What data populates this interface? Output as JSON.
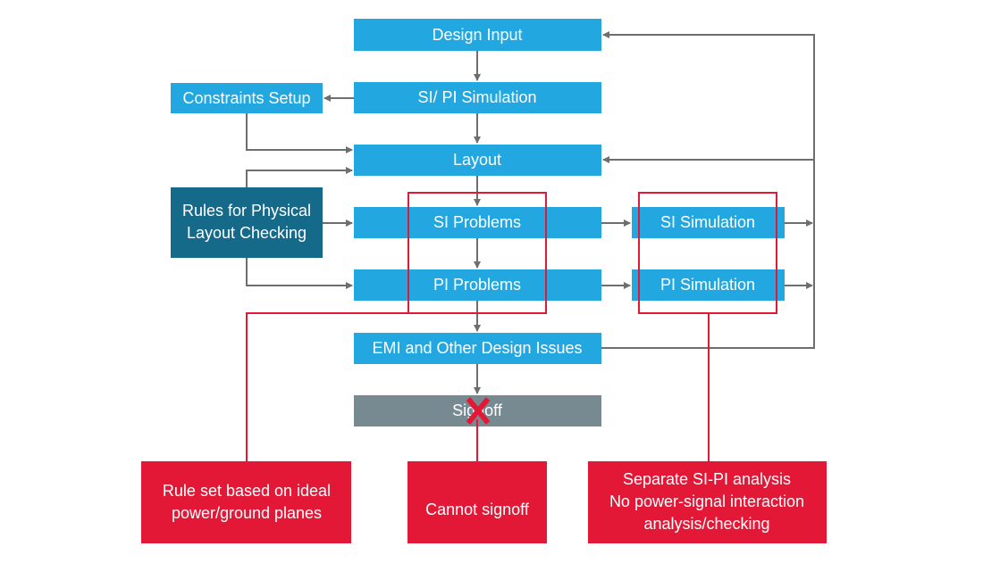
{
  "colors": {
    "process": "#22a7e0",
    "rules": "#156a8a",
    "signoff": "#778a92",
    "alert": "#e31837",
    "connector": "#6d6e70"
  },
  "nodes": {
    "design_input": "Design Input",
    "sipi_sim": "SI/ PI Simulation",
    "constraints": "Constraints Setup",
    "layout": "Layout",
    "rules_line1": "Rules for Physical",
    "rules_line2": "Layout Checking",
    "si_problems": "SI Problems",
    "pi_problems": "PI Problems",
    "si_simulation": "SI Simulation",
    "pi_simulation": "PI Simulation",
    "emi": "EMI and Other Design Issues",
    "signoff": "Signoff"
  },
  "callouts": {
    "left": [
      "Rule set based on ideal",
      "power/ground  planes"
    ],
    "middle": [
      "Cannot signoff"
    ],
    "right": [
      "Separate SI-PI analysis",
      "No power-signal interaction",
      "analysis/checking"
    ]
  },
  "icons": {
    "signoff_blocked": "x-mark-icon"
  }
}
